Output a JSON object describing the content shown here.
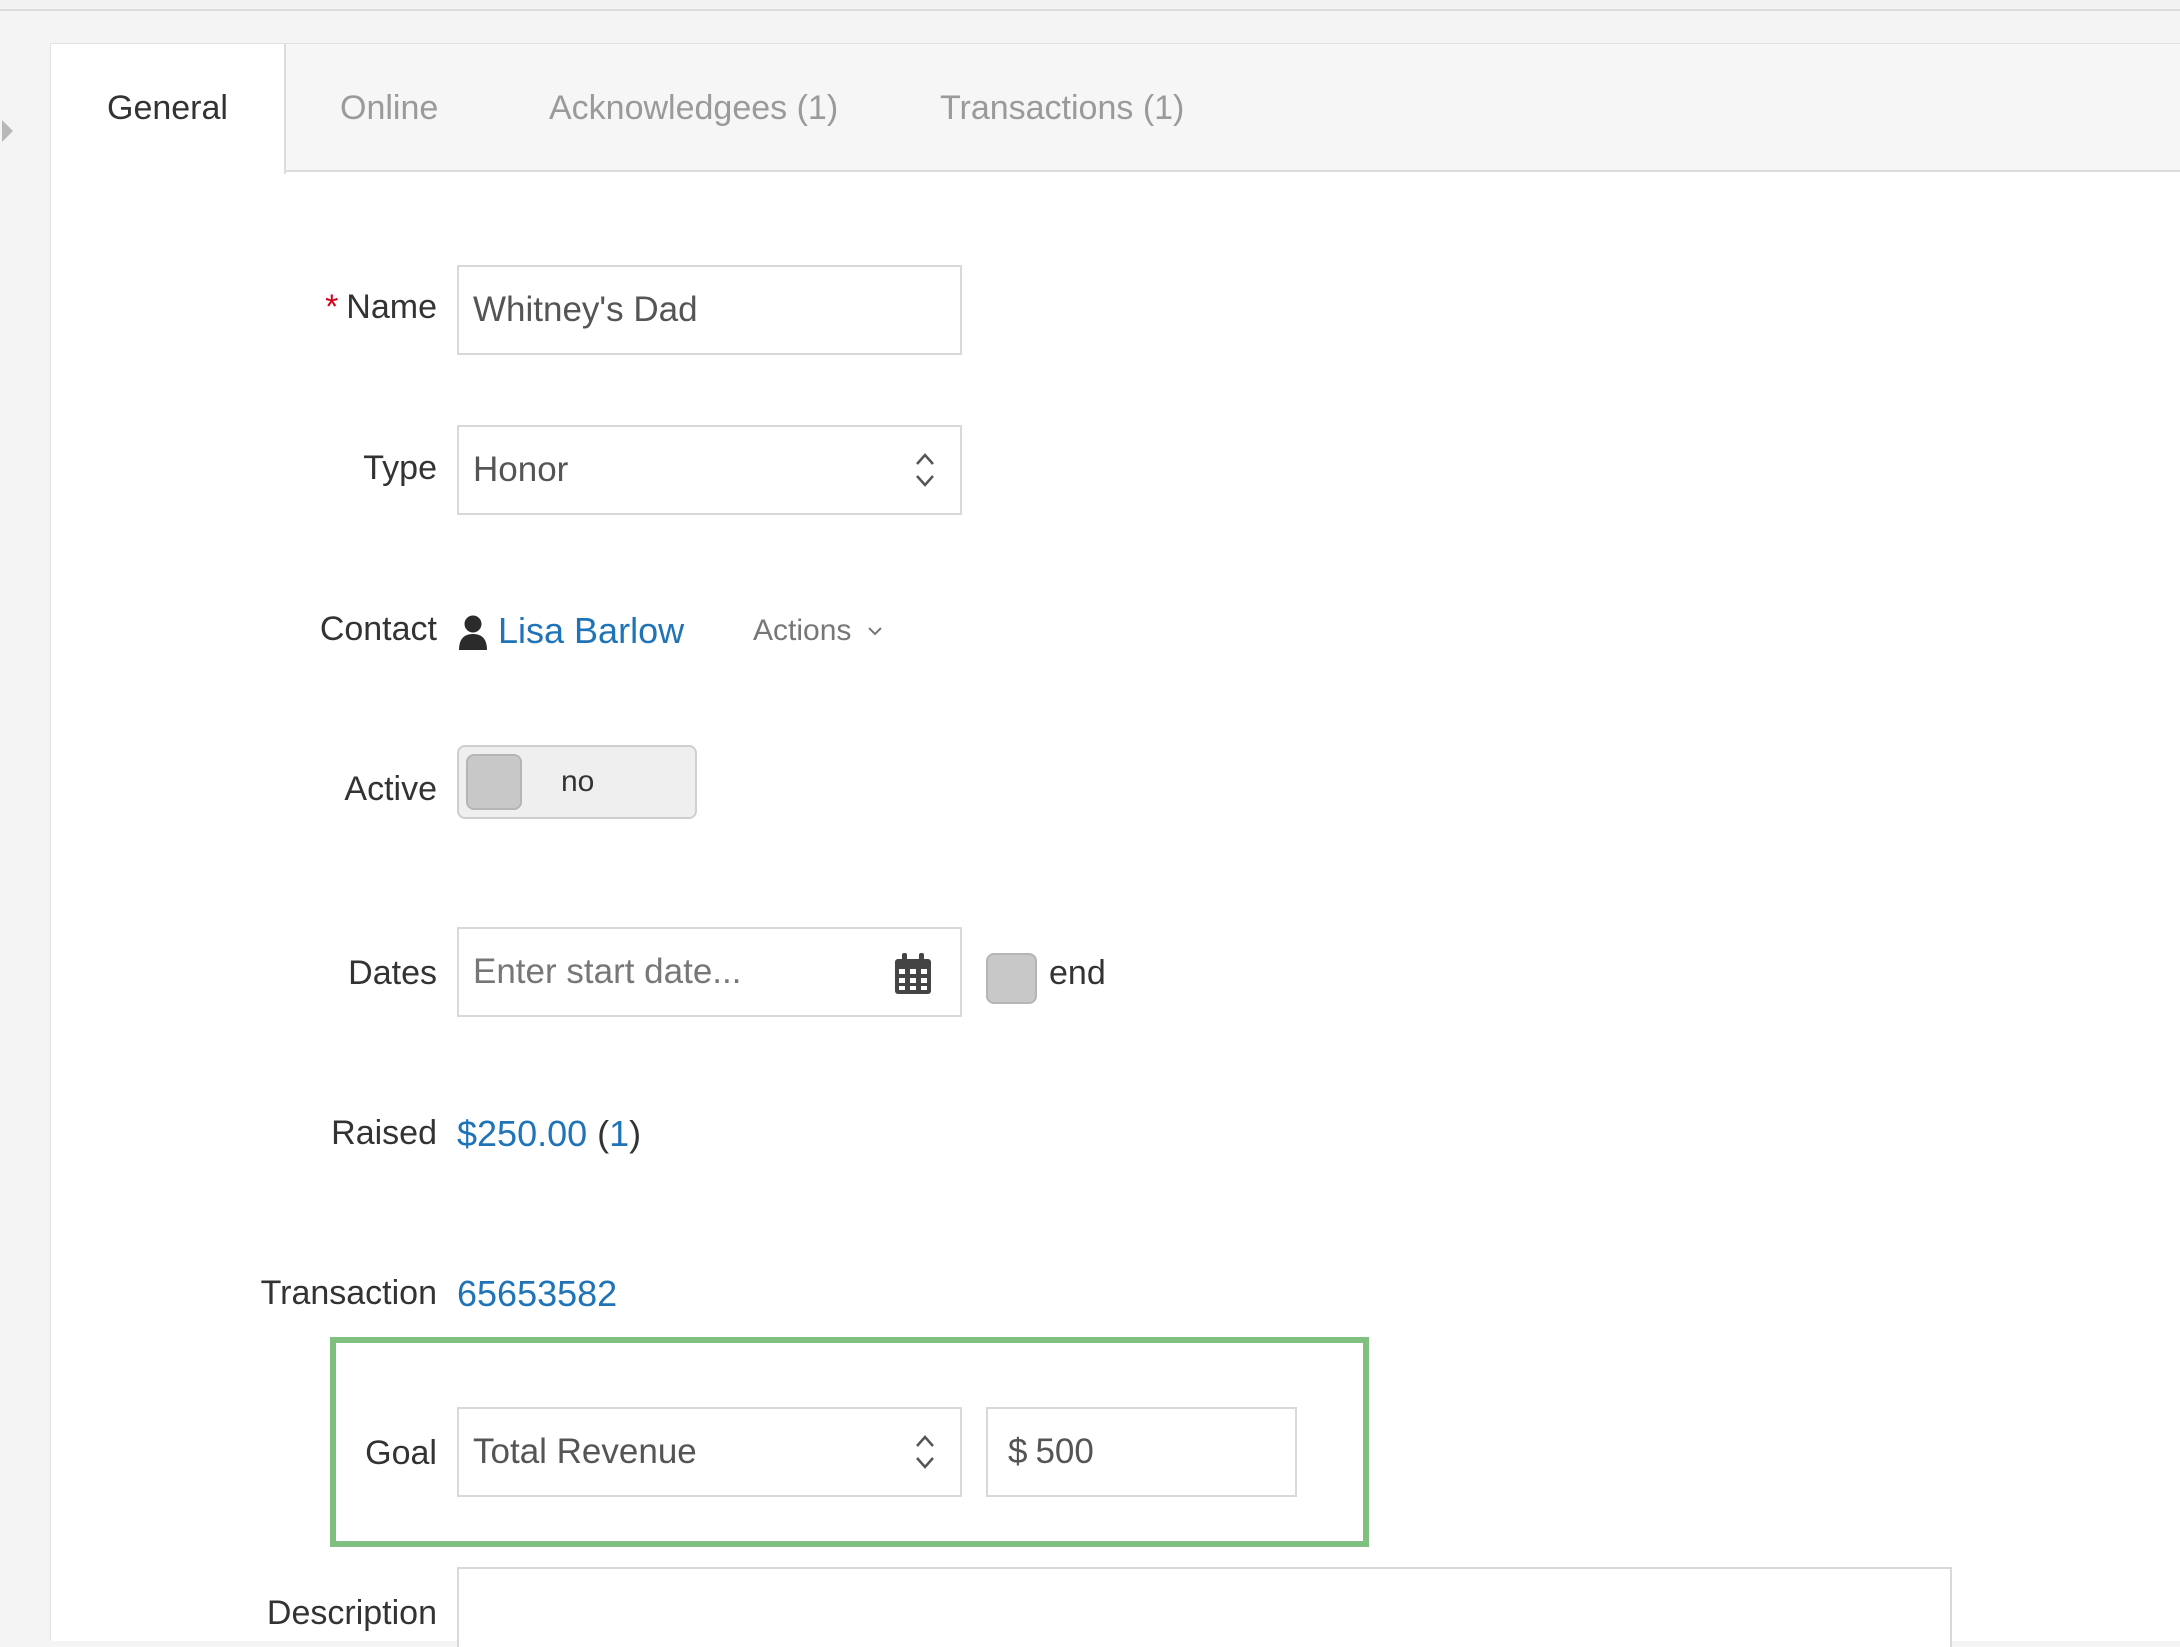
{
  "tabs": [
    {
      "label": "General"
    },
    {
      "label": "Online"
    },
    {
      "label": "Acknowledgees (1)"
    },
    {
      "label": "Transactions (1)"
    }
  ],
  "form": {
    "name": {
      "required_mark": "*",
      "label": "Name",
      "value": "Whitney's Dad"
    },
    "type": {
      "label": "Type",
      "value": "Honor"
    },
    "contact": {
      "label": "Contact",
      "name": "Lisa Barlow",
      "actions_label": "Actions"
    },
    "active": {
      "label": "Active",
      "value": "no"
    },
    "dates": {
      "label": "Dates",
      "start_placeholder": "Enter start date...",
      "end_label": "end"
    },
    "raised": {
      "label": "Raised",
      "amount": "$250.00",
      "count_open": " (",
      "count": "1",
      "count_close": ")"
    },
    "transaction": {
      "label": "Transaction",
      "value": "65653582"
    },
    "goal": {
      "label": "Goal",
      "type_value": "Total Revenue",
      "currency": "$",
      "amount": "500"
    },
    "description": {
      "label": "Description"
    }
  },
  "colors": {
    "link": "#1f73b7",
    "required": "#d0021b",
    "highlight": "#7fbf7f"
  }
}
